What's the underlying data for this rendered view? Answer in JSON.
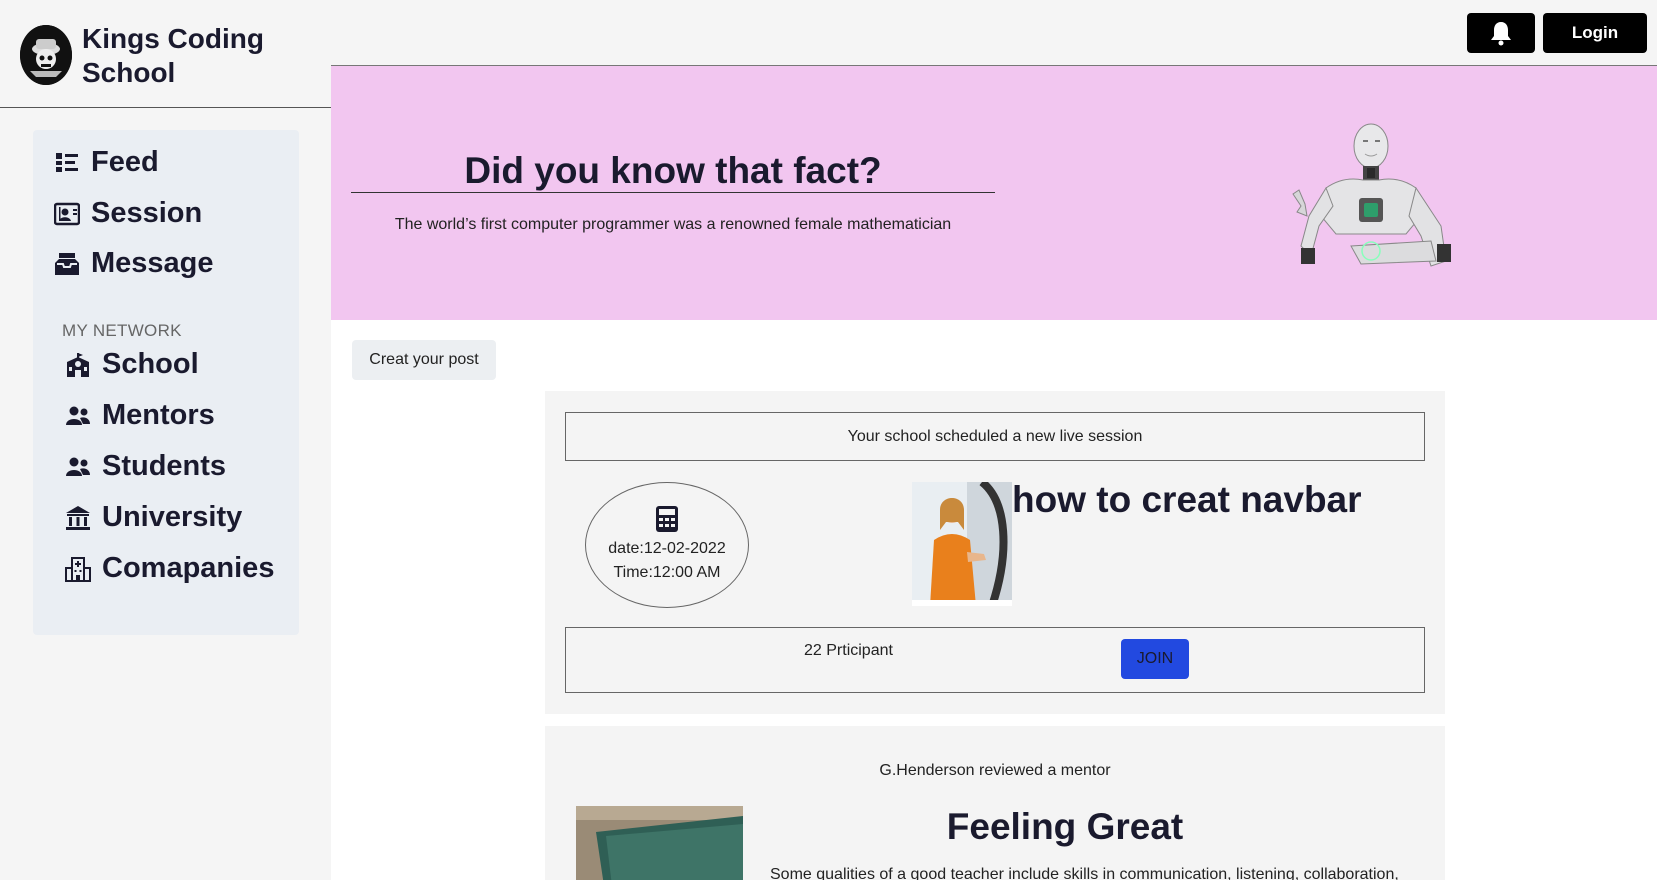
{
  "brand": {
    "name": "Kings Coding School"
  },
  "topbar": {
    "login_label": "Login"
  },
  "sidebar": {
    "items": [
      {
        "label": "Feed",
        "icon": "feed-icon"
      },
      {
        "label": "Session",
        "icon": "session-icon"
      },
      {
        "label": "Message",
        "icon": "inbox-icon"
      }
    ],
    "network_heading": "MY NETWORK",
    "network_items": [
      {
        "label": "School",
        "icon": "school-icon"
      },
      {
        "label": "Mentors",
        "icon": "users-icon"
      },
      {
        "label": "Students",
        "icon": "users-icon"
      },
      {
        "label": "University",
        "icon": "university-icon"
      },
      {
        "label": "Comapanies",
        "icon": "building-icon"
      }
    ]
  },
  "hero": {
    "title": "Did you know that fact?",
    "text": "The world’s first computer programmer was a renowned female mathematician",
    "background": "#f2c6f0"
  },
  "main": {
    "create_post_label": "Creat your post",
    "session_card": {
      "notice": "Your school scheduled a new live session",
      "date": "date:12-02-2022",
      "time": "Time:12:00 AM",
      "title": "how to creat navbar",
      "participants": "22 Prticipant",
      "join_label": "JOIN",
      "join_color": "#2249e0"
    },
    "review_card": {
      "heading": "G.Henderson reviewed a mentor",
      "title": "Feeling Great",
      "text": "Some qualities of a good teacher include skills in communication, listening, collaboration,"
    }
  }
}
